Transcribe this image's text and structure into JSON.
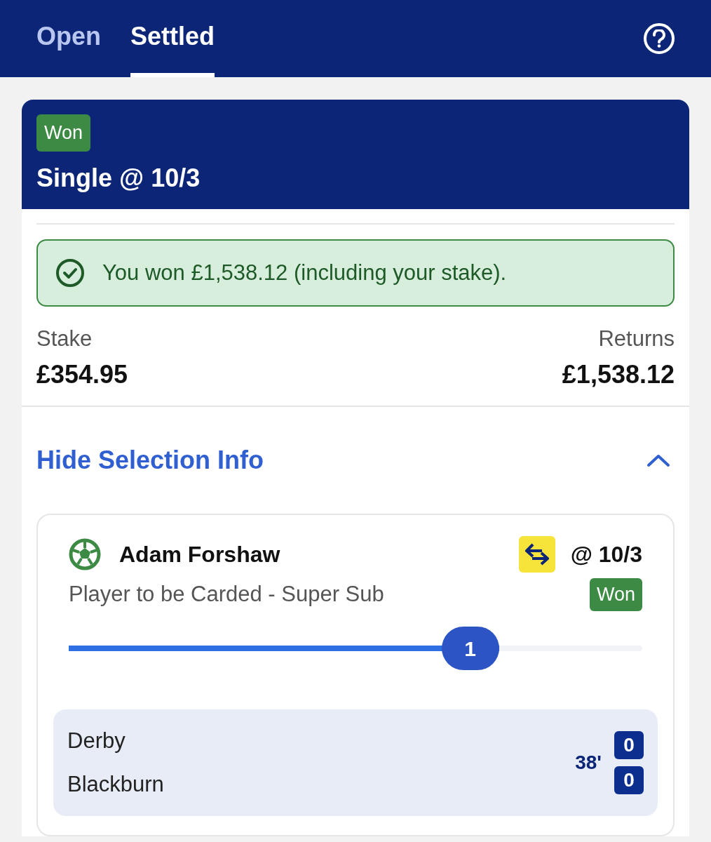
{
  "tabs": [
    {
      "label": "Open",
      "selected": false
    },
    {
      "label": "Settled",
      "selected": true
    }
  ],
  "bet": {
    "status": "Won",
    "title": "Single @ 10/3",
    "alert": "You won £1,538.12 (including your stake).",
    "stake_label": "Stake",
    "stake": "£354.95",
    "returns_label": "Returns",
    "returns": "£1,538.12",
    "toggle": {
      "label": "Hide Selection Info",
      "expanded": true
    },
    "selection": {
      "name": "Adam Forshaw",
      "odds": "@ 10/3",
      "market": "Player to be Carded - Super Sub",
      "status": "Won",
      "progress": {
        "level": 0.75,
        "label": "1"
      },
      "match": {
        "teams": [
          {
            "name": "Derby",
            "score": "0"
          },
          {
            "name": "Blackburn",
            "score": "0"
          }
        ],
        "time": "38'"
      }
    }
  }
}
